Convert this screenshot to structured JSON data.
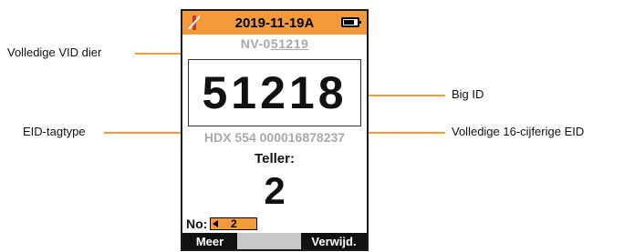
{
  "device": {
    "status_bar": {
      "date": "2019-11-19A",
      "left_icon": "no-signal-icon",
      "right_icon": "battery-icon",
      "color": "#f39a3b"
    },
    "vid_prefix": "NV-0",
    "vid_digits": "51219",
    "big_id": "51218",
    "eid": "HDX 554 000016878237",
    "teller_label": "Teller:",
    "teller_value": "2",
    "no_label": "No:",
    "no_value": "2",
    "softkeys": {
      "left": "Meer",
      "middle": "",
      "right": "Verwijd."
    }
  },
  "callouts": {
    "vid": "Volledige VID dier",
    "tag_type": "EID-tagtype",
    "big_id": "Big ID",
    "eid": "Volledige 16-cijferige EID"
  }
}
